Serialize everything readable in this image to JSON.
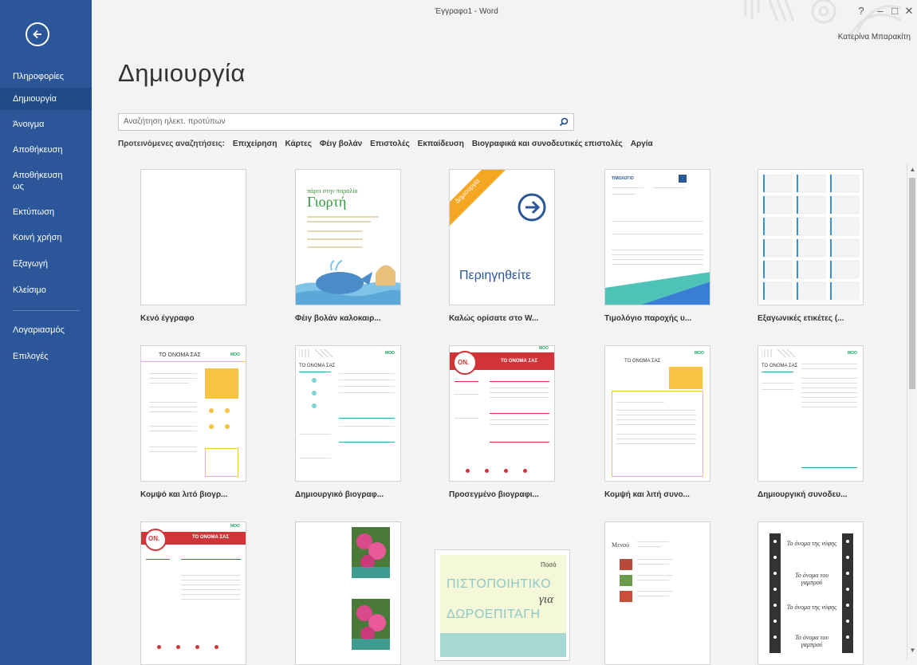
{
  "window": {
    "title": "Έγγραφο1 - Word",
    "user": "Κατερίνα Μπαρακίτη"
  },
  "sidebar": {
    "items": [
      {
        "label": "Πληροφορίες"
      },
      {
        "label": "Δημιουργία"
      },
      {
        "label": "Άνοιγμα"
      },
      {
        "label": "Αποθήκευση"
      },
      {
        "label": "Αποθήκευση ως"
      },
      {
        "label": "Εκτύπωση"
      },
      {
        "label": "Κοινή χρήση"
      },
      {
        "label": "Εξαγωγή"
      },
      {
        "label": "Κλείσιμο"
      },
      {
        "label": "Λογαριασμός"
      },
      {
        "label": "Επιλογές"
      }
    ]
  },
  "main": {
    "title": "Δημιουργία",
    "search_placeholder": "Αναζήτηση ηλεκτ. προτύπων",
    "suggested_label": "Προτεινόμενες αναζητήσεις:",
    "suggested": [
      "Επιχείρηση",
      "Κάρτες",
      "Φέιγ βολάν",
      "Επιστολές",
      "Εκπαίδευση",
      "Βιογραφικά και συνοδευτικές επιστολές",
      "Αργία"
    ]
  },
  "templates": [
    {
      "caption": "Κενό έγγραφο"
    },
    {
      "caption": "Φέιγ βολάν καλοκαιρ..."
    },
    {
      "caption": "Καλώς ορίσατε στο W..."
    },
    {
      "caption": "Τιμολόγιο παροχής υ..."
    },
    {
      "caption": "Εξαγωνικές ετικέτες (..."
    },
    {
      "caption": "Κομψό και λιτό βιογρ..."
    },
    {
      "caption": "Δημιουργικό βιογραφ..."
    },
    {
      "caption": "Προσεγμένο βιογραφι..."
    },
    {
      "caption": "Κομψή και λιτή συνο..."
    },
    {
      "caption": "Δημιουργική συνοδευ..."
    }
  ],
  "thumb_text": {
    "flyer_title": "πάρτι στην παραλία",
    "flyer_big": "Γιορτή",
    "welcome_banner": "Δημιουργία",
    "welcome_text": "Περιηγηθείτε",
    "invoice_title": "ΤΙΜΟΛΟΓΙΟ",
    "resume_name": "ΤΟ ΟΝΟΜΑ ΣΑΣ",
    "moo": "MOO",
    "on_badge": "ON.",
    "menu_title": "Μενού",
    "cert_for": "Ποσό",
    "cert_line1": "ΠΙΣΤΟΠΟΙΗΤΙΚΟ",
    "cert_line2": "για",
    "cert_line3": "ΔΩΡΟΕΠΙΤΑΓΗ",
    "label_bride": "Το όνομα της νύφης",
    "label_groom": "Το όνομα του γαμπρού"
  },
  "colors": {
    "sidebar": "#2b579a",
    "sidebar_active": "#1e4a87",
    "accent_red": "#d13438",
    "accent_teal": "#3aa5a5",
    "accent_yellow": "#f6c343",
    "moo_green": "#1aa260"
  }
}
